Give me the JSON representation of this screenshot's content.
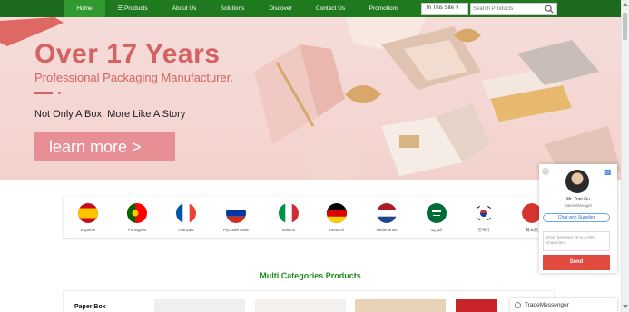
{
  "nav": {
    "items": [
      {
        "label": "Home"
      },
      {
        "label": "☰ Products"
      },
      {
        "label": "About Us"
      },
      {
        "label": "Solutions"
      },
      {
        "label": "Discover"
      },
      {
        "label": "Contact Us"
      },
      {
        "label": "Promotions"
      }
    ],
    "site_select": "In This Site ∨",
    "search_placeholder": "Search Products"
  },
  "hero": {
    "title": "Over 17 Years",
    "subtitle": "Professional Packaging Manufacturer.",
    "tagline": "Not Only A Box, More Like A Story",
    "button": "learn more  >"
  },
  "languages": [
    {
      "label": "Español"
    },
    {
      "label": "Português"
    },
    {
      "label": "Français"
    },
    {
      "label": "Русский язык"
    },
    {
      "label": "Italiano"
    },
    {
      "label": "Deutsch"
    },
    {
      "label": "Nederlands"
    },
    {
      "label": "العربية"
    },
    {
      "label": "한국어"
    },
    {
      "label": "日本語"
    }
  ],
  "section": {
    "title": "Multi Categories Products"
  },
  "category": {
    "label": "Paper Box"
  },
  "chat": {
    "close": "×",
    "name": "Mr. Tom Gu",
    "role": "Sales Manager",
    "chat_button": "Chat with Supplier",
    "textarea_placeholder": "Enter between 20 to 4,000 characters.",
    "send": "Send"
  },
  "trade": {
    "label": "TradeMessenger"
  },
  "colors": {
    "nav": "#1f7a1f",
    "accent": "#d46262",
    "send": "#e04a3f"
  }
}
